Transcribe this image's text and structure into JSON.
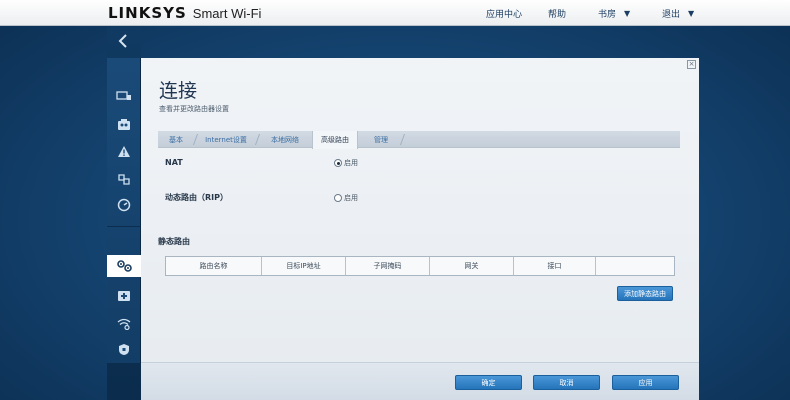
{
  "header": {
    "brand": "LINKSYS",
    "brand_sub": "Smart Wi-Fi",
    "nav": {
      "app_center": "应用中心",
      "help": "帮助",
      "router_name": "书房",
      "logout": "退出"
    }
  },
  "sidebar": {
    "back_icon": "chevron-left-icon",
    "items": [
      {
        "icon": "devices-icon"
      },
      {
        "icon": "parental-controls-icon"
      },
      {
        "icon": "alert-icon"
      },
      {
        "icon": "media-prioritization-icon"
      },
      {
        "icon": "speed-test-icon"
      },
      {
        "icon": "connectivity-gear-icon",
        "active": true
      },
      {
        "icon": "troubleshooting-icon"
      },
      {
        "icon": "wireless-icon"
      },
      {
        "icon": "security-icon"
      }
    ]
  },
  "page": {
    "title": "连接",
    "subtitle": "查看并更改路由器设置",
    "tabs": [
      "基本",
      "Internet设置",
      "本地网络",
      "高级路由",
      "管理"
    ],
    "active_tab": "高级路由"
  },
  "form": {
    "nat_label": "NAT",
    "nat_option": "启用",
    "nat_checked": true,
    "rip_label": "动态路由（RIP）",
    "rip_option": "启用",
    "rip_checked": false
  },
  "static_routing": {
    "title": "静态路由",
    "columns": [
      "路由名称",
      "目标IP地址",
      "子网掩码",
      "网关",
      "接口",
      ""
    ],
    "add_button": "添加静态路由"
  },
  "footer": {
    "ok": "确定",
    "cancel": "取消",
    "apply": "应用"
  },
  "colors": {
    "accent": "#2f7fc4",
    "background": "#154674",
    "panel": "#eef2f6"
  }
}
